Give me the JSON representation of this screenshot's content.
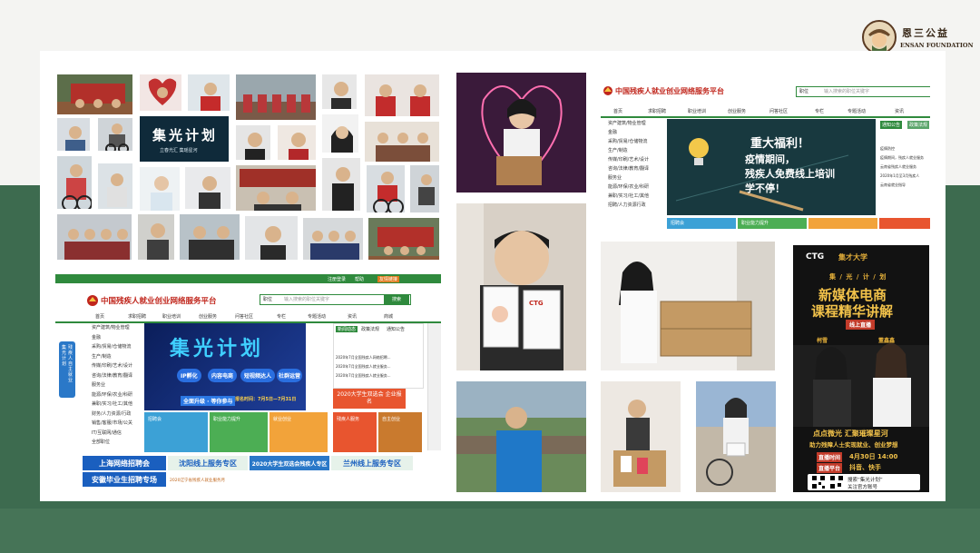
{
  "logo": {
    "cn": "恩三公益",
    "en": "ENSAN FOUNDATION"
  },
  "collage": {
    "sign_text": "集光计划",
    "sign_sub": "立春光汇 集瑶星河"
  },
  "site1": {
    "title": "中国残疾人就业创业网络服务平台",
    "search_label": "职位",
    "search_placeholder": "输入搜索的职位关键字",
    "search_button": "搜索",
    "top_links": [
      "注册登录",
      "帮助",
      "友情链接"
    ],
    "nav": [
      "首页",
      "求职招聘",
      "职业培训",
      "创业服务",
      "问答社区",
      "专栏",
      "专题活动",
      "资讯",
      "商城"
    ],
    "side": [
      "资产建筑/物业管理",
      "金融",
      "采购/贸易/仓储物流",
      "生产/制造",
      "传媒/印刷/艺术/设计",
      "咨询/法律/教育/翻译",
      "服务业",
      "能源/环保/农业/科研",
      "兼职/实习/社工/其他",
      "财务/人力资源/行政",
      "销售/客服/市场/公关",
      "IT/互联网/通信",
      "全部职位"
    ],
    "banner_title": "集光计划",
    "banner_tags": [
      "IP孵化",
      "内容电商",
      "短视频达人",
      "社群运营"
    ],
    "banner_cta": "全面升级 · 等你参与",
    "banner_date": "报名时间：7月5日—7月31日",
    "right_tabs": [
      "新闻动态",
      "政策法规",
      "通知公告"
    ],
    "right_news": [
      "2020年7月全国残疾人网络招聘...",
      "2020年7月全国残疾人就业服务...",
      "2020年7月全国残疾人就业服务..."
    ],
    "expo": "2020大学生双选会 企业报名",
    "tiles": [
      "招聘会",
      "职业能力提升",
      "就业创业",
      "残疾人服务",
      "自主创业"
    ],
    "bottom": [
      "上海网络招聘会",
      "沈阳线上服务专区",
      "2020大学生双选会残疾人专区",
      "兰州线上服务专区",
      "安徽毕业生招聘专场"
    ],
    "bottom_sub": "2020辽宁省残疾人就业服务月",
    "floating": [
      "集光计划",
      "残疾人自主就业"
    ]
  },
  "site2": {
    "title": "中国残疾人就业创业网络服务平台",
    "search_label": "职位",
    "search_placeholder": "输入搜索的职位关键字",
    "nav": [
      "首页",
      "求职招聘",
      "职业培训",
      "创业服务",
      "问答社区",
      "专栏",
      "专题活动",
      "资讯"
    ],
    "side": [
      "资产建筑/物业管理",
      "金融",
      "采购/贸易/仓储物流",
      "生产/制造",
      "传媒/印刷/艺术/设计",
      "咨询/法律/教育/翻译",
      "服务业",
      "能源/环保/农业/科研",
      "兼职/实习/社工/其他",
      "招聘/人力资源行政"
    ],
    "banner": [
      "重大福利！",
      "疫情期间，",
      "残疾人免费线上培训",
      "学不停！"
    ],
    "right_tabs": [
      "通知公告",
      "政策法规"
    ],
    "right_news": [
      "疫情防控",
      "疫情期间，残疾人就业服务",
      "云南省残疾人就业服务",
      "2020年1月至3月残疾人",
      "云南省就业指导"
    ],
    "tiles": [
      "招聘会",
      "职业能力提升"
    ]
  },
  "products": {
    "box_label": "CTG"
  },
  "poster": {
    "ctg": "CTG",
    "partner": "集才大学",
    "series": "集 / 光 / 计 / 划",
    "title1": "新媒体电商",
    "title2": "课程精华讲解",
    "live": "线上直播",
    "left_name": "柯雪",
    "right_name": "董鑫鑫",
    "slogan1": "点点微光 汇聚璀璨星河",
    "slogan2": "助力残障人士实现就业、创业梦想",
    "time_label": "直播时间",
    "time_value": "4月30日 14:00",
    "platform_label": "直播平台",
    "platform_value": "抖音、快手",
    "qr_caption1": "搜索“集光计划”",
    "qr_caption2": "关注官方账号"
  },
  "colors": {
    "green_band": "#3d6b4f",
    "site_green": "#2f8a3d",
    "site_red": "#c0261c",
    "poster_gold": "#e8b23a"
  }
}
